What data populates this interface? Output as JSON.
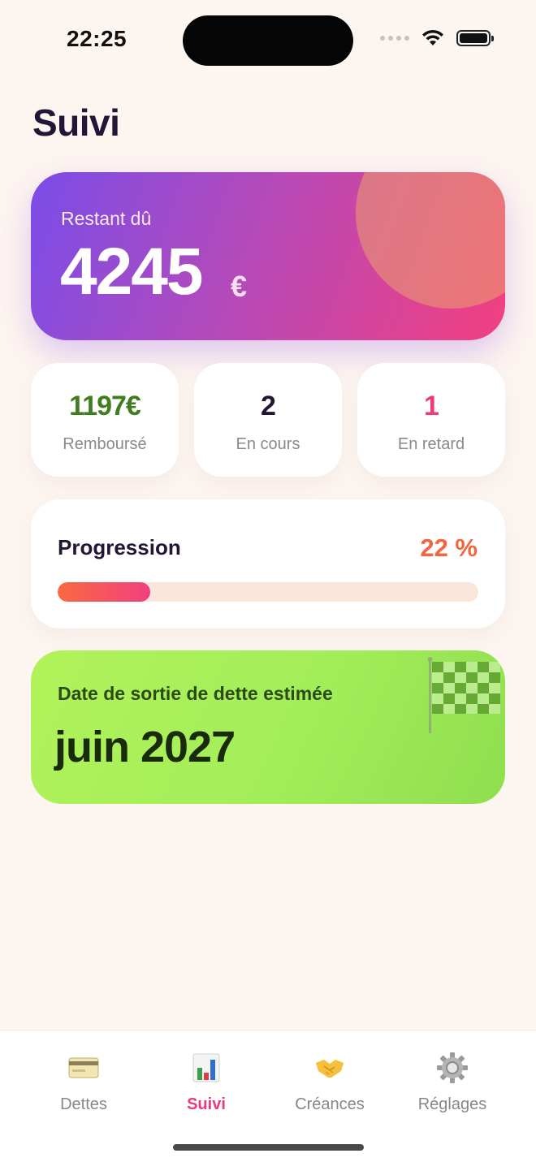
{
  "status_bar": {
    "time": "22:25"
  },
  "page": {
    "title": "Suivi"
  },
  "summary": {
    "label": "Restant dû",
    "amount": "4245",
    "currency": "€"
  },
  "stats": [
    {
      "value": "1197€",
      "label": "Remboursé",
      "color": "#3f7d1f"
    },
    {
      "value": "2",
      "label": "En cours",
      "color": "#221536"
    },
    {
      "value": "1",
      "label": "En retard",
      "color": "#f03a73"
    }
  ],
  "progress": {
    "label": "Progression",
    "percent_text": "22 %",
    "percent": 22
  },
  "exit_estimate": {
    "label": "Date de sortie de dette estimée",
    "date": "juin 2027",
    "icon": "checkered-flag-icon"
  },
  "tabs": [
    {
      "label": "Dettes",
      "icon": "credit-card-icon",
      "active": false
    },
    {
      "label": "Suivi",
      "icon": "bar-chart-icon",
      "active": true
    },
    {
      "label": "Créances",
      "icon": "handshake-icon",
      "active": false
    },
    {
      "label": "Réglages",
      "icon": "gear-icon",
      "active": false
    }
  ],
  "colors": {
    "accent": "#e83a7e",
    "background": "#fdf5f0",
    "progress": "#f2663f"
  }
}
